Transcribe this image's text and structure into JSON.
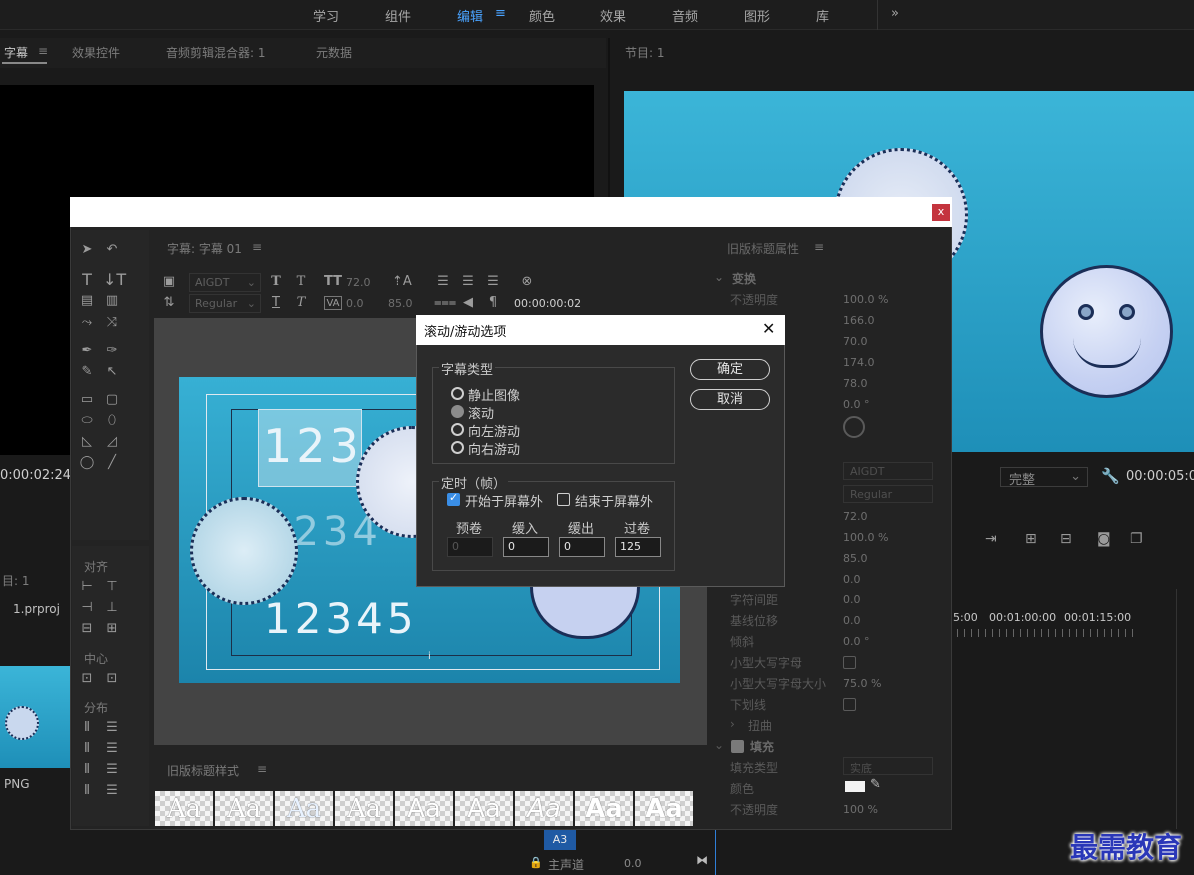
{
  "workspaces": [
    "学习",
    "组件",
    "编辑",
    "颜色",
    "效果",
    "音频",
    "图形",
    "库"
  ],
  "workspace_active": "编辑",
  "workspace_more": "»",
  "panels": {
    "subtitle": "字幕",
    "effect_controls": "效果控件",
    "audio_mixer": "音频剪辑混合器: 1",
    "metadata": "元数据",
    "program": "节目: 1"
  },
  "source_timecode": "0:00:02:24",
  "program_timecode": "00:00:05:0",
  "program_quality": "完整",
  "project": {
    "name": "目: 1",
    "file": "1.prproj",
    "thumb_label": "PNG"
  },
  "ruler": [
    "5:00",
    "00:01:00:00",
    "00:01:15:00"
  ],
  "timeline": {
    "track": "A3",
    "master": "主声道",
    "master_val": "0.0"
  },
  "titler": {
    "close": "x",
    "panel_title": "字幕: 字幕 01",
    "font": "AIGDT",
    "style": "Regular",
    "size": "72.0",
    "kern": "0.0",
    "leading": "85.0",
    "timecode": "00:00:00:02",
    "align_label": "对齐",
    "center_label": "中心",
    "distribute_label": "分布",
    "styles_label": "旧版标题样式",
    "style_swatches": [
      "Aa",
      "Aa",
      "Aa",
      "Aa",
      "Aa",
      "Aa",
      "Aa",
      "Aa",
      "Aa"
    ],
    "canvas_text": [
      "123",
      "1234",
      "12345"
    ],
    "cursor_char": "i"
  },
  "props": {
    "title": "旧版标题属性",
    "transform": "变换",
    "rows": [
      {
        "label": "不透明度",
        "value": "100.0 %"
      },
      {
        "label": "",
        "value": "166.0"
      },
      {
        "label": "",
        "value": "70.0"
      },
      {
        "label": "",
        "value": "174.0"
      },
      {
        "label": "",
        "value": "78.0"
      },
      {
        "label": "",
        "value": "0.0 °"
      }
    ],
    "font": "AIGDT",
    "style": "Regular",
    "vals": [
      "72.0",
      "100.0 %",
      "85.0",
      "0.0",
      "0.0"
    ],
    "rows2": [
      {
        "label": "字符间距",
        "value": "0.0"
      },
      {
        "label": "基线位移",
        "value": "0.0"
      },
      {
        "label": "倾斜",
        "value": "0.0 °"
      },
      {
        "label": "小型大写字母",
        "value": ""
      },
      {
        "label": "小型大写字母大小",
        "value": "75.0 %"
      },
      {
        "label": "下划线",
        "value": ""
      }
    ],
    "distort": "扭曲",
    "fill": "填充",
    "fill_type": "填充类型",
    "fill_type_val": "实底",
    "color": "颜色",
    "opacity": "不透明度",
    "opacity_val": "100 %"
  },
  "roll_dialog": {
    "title": "滚动/游动选项",
    "close": "✕",
    "type_group": "字幕类型",
    "types": [
      "静止图像",
      "滚动",
      "向左游动",
      "向右游动"
    ],
    "selected": "滚动",
    "timing_group": "定时（帧）",
    "start_off": "开始于屏幕外",
    "start_off_checked": true,
    "end_off": "结束于屏幕外",
    "end_off_checked": false,
    "fields": [
      {
        "label": "预卷",
        "value": "0",
        "disabled": true
      },
      {
        "label": "缓入",
        "value": "0"
      },
      {
        "label": "缓出",
        "value": "0"
      },
      {
        "label": "过卷",
        "value": "125"
      }
    ],
    "ok": "确定",
    "cancel": "取消"
  },
  "watermark": "最需教育"
}
